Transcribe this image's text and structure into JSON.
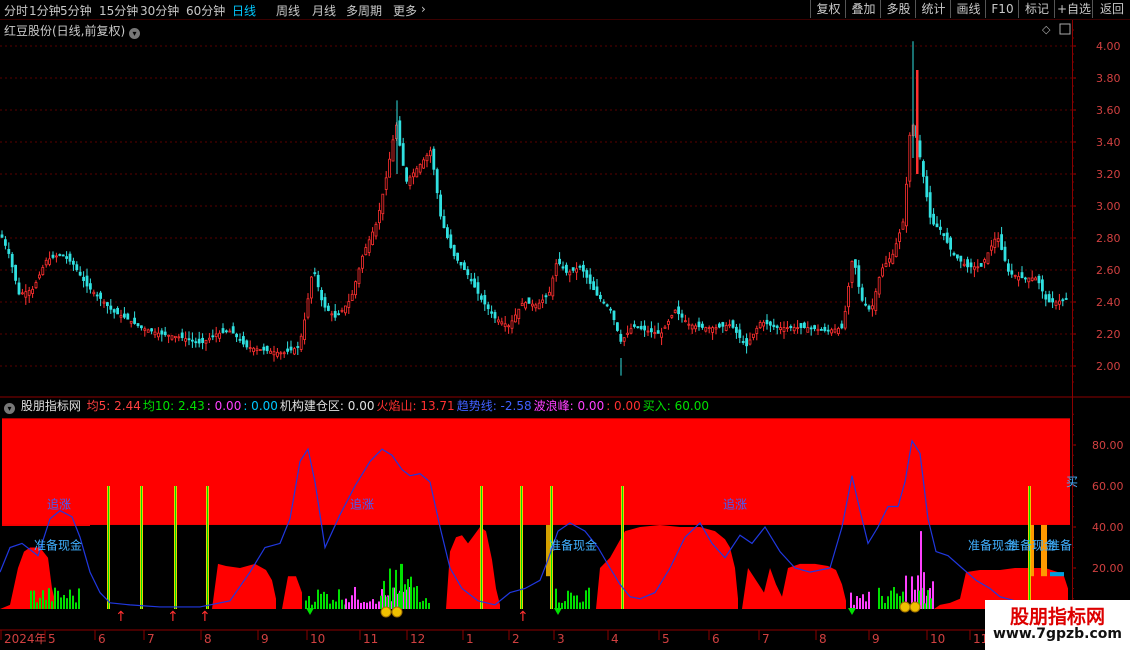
{
  "toolbar": {
    "periods": [
      "分时",
      "1分钟",
      "5分钟",
      "15分钟",
      "30分钟",
      "60分钟",
      "日线",
      "周线",
      "月线",
      "多周期",
      "更多"
    ],
    "active_period": "日线",
    "buttons": [
      "复权",
      "叠加",
      "多股",
      "统计",
      "画线",
      "F10",
      "标记",
      "+自选",
      "返回"
    ]
  },
  "stock_title": "红豆股份(日线,前复权)",
  "indicator": {
    "name": "股朋指标网",
    "items": [
      {
        "label": "均5: 2.44",
        "color": "#ff4040"
      },
      {
        "label": "均10: 2.43",
        "color": "#00e000"
      },
      {
        "label": ": 0.00",
        "color": "#ff40ff"
      },
      {
        "label": ": 0.00",
        "color": "#00c8ff"
      },
      {
        "label": "机构建仓区: 0.00",
        "color": "#e0e0e0"
      },
      {
        "label": "火焰山: 13.71",
        "color": "#ff3030"
      },
      {
        "label": "趋势线: -2.58",
        "color": "#4060ff"
      },
      {
        "label": "波浪峰: 0.00",
        "color": "#ff40ff"
      },
      {
        "label": ": 0.00",
        "color": "#ff3030"
      },
      {
        "label": "买入: 60.00",
        "color": "#00e000"
      }
    ]
  },
  "watermark": {
    "line1": "股朋指标网",
    "line2": "www.7gpzb.com"
  },
  "colors": {
    "up": "#ff3030",
    "down": "#30e0e0",
    "grid": "#5a0000",
    "flame": "#ff0000",
    "trend": "#2038e0",
    "buy": "#00e000"
  },
  "chart_data": [
    {
      "type": "candlestick",
      "title": "红豆股份(日线,前复权)",
      "ylim": [
        1.9,
        4.1
      ],
      "yticks": [
        "2.00",
        "2.20",
        "2.40",
        "2.60",
        "2.80",
        "3.00",
        "3.20",
        "3.40",
        "3.60",
        "3.80",
        "4.00"
      ],
      "x_labels": [
        "2024年",
        "5",
        "6",
        "7",
        "8",
        "9",
        "10",
        "11",
        "12",
        "1",
        "2",
        "3",
        "4",
        "5",
        "6",
        "7",
        "8",
        "9",
        "10",
        "11"
      ],
      "close_path": [
        [
          0,
          2.82
        ],
        [
          8,
          2.7
        ],
        [
          18,
          2.45
        ],
        [
          32,
          2.48
        ],
        [
          45,
          2.66
        ],
        [
          60,
          2.7
        ],
        [
          72,
          2.64
        ],
        [
          86,
          2.5
        ],
        [
          100,
          2.42
        ],
        [
          112,
          2.34
        ],
        [
          125,
          2.3
        ],
        [
          140,
          2.24
        ],
        [
          160,
          2.2
        ],
        [
          180,
          2.18
        ],
        [
          200,
          2.14
        ],
        [
          215,
          2.2
        ],
        [
          230,
          2.22
        ],
        [
          245,
          2.12
        ],
        [
          262,
          2.1
        ],
        [
          282,
          2.08
        ],
        [
          298,
          2.12
        ],
        [
          304,
          2.3
        ],
        [
          312,
          2.62
        ],
        [
          322,
          2.38
        ],
        [
          335,
          2.3
        ],
        [
          350,
          2.42
        ],
        [
          362,
          2.7
        ],
        [
          376,
          2.9
        ],
        [
          386,
          3.2
        ],
        [
          395,
          3.52
        ],
        [
          405,
          3.15
        ],
        [
          418,
          3.25
        ],
        [
          430,
          3.35
        ],
        [
          440,
          2.92
        ],
        [
          452,
          2.7
        ],
        [
          466,
          2.58
        ],
        [
          480,
          2.42
        ],
        [
          494,
          2.3
        ],
        [
          508,
          2.25
        ],
        [
          522,
          2.4
        ],
        [
          536,
          2.38
        ],
        [
          548,
          2.45
        ],
        [
          556,
          2.66
        ],
        [
          566,
          2.58
        ],
        [
          580,
          2.62
        ],
        [
          595,
          2.45
        ],
        [
          610,
          2.35
        ],
        [
          620,
          2.15
        ],
        [
          632,
          2.25
        ],
        [
          646,
          2.22
        ],
        [
          660,
          2.2
        ],
        [
          674,
          2.35
        ],
        [
          688,
          2.26
        ],
        [
          702,
          2.24
        ],
        [
          716,
          2.24
        ],
        [
          730,
          2.26
        ],
        [
          745,
          2.12
        ],
        [
          760,
          2.28
        ],
        [
          775,
          2.24
        ],
        [
          790,
          2.24
        ],
        [
          808,
          2.24
        ],
        [
          825,
          2.22
        ],
        [
          842,
          2.24
        ],
        [
          852,
          2.7
        ],
        [
          860,
          2.42
        ],
        [
          870,
          2.34
        ],
        [
          880,
          2.6
        ],
        [
          892,
          2.7
        ],
        [
          903,
          2.92
        ],
        [
          910,
          3.55
        ],
        [
          915,
          3.45
        ],
        [
          922,
          3.2
        ],
        [
          930,
          2.9
        ],
        [
          940,
          2.85
        ],
        [
          952,
          2.7
        ],
        [
          966,
          2.62
        ],
        [
          980,
          2.62
        ],
        [
          996,
          2.82
        ],
        [
          1008,
          2.58
        ],
        [
          1022,
          2.55
        ],
        [
          1036,
          2.55
        ],
        [
          1046,
          2.4
        ],
        [
          1055,
          2.4
        ],
        [
          1066,
          2.42
        ]
      ]
    },
    {
      "type": "area",
      "title": "股朋指标网",
      "ylim": [
        0,
        100
      ],
      "yticks": [
        "20.00",
        "40.00",
        "60.00",
        "80.00"
      ],
      "series": [
        {
          "name": "火焰山",
          "values": [
            13.71
          ]
        },
        {
          "name": "趋势线",
          "values": [
            -2.58
          ]
        },
        {
          "name": "买入",
          "values": [
            60.0
          ]
        }
      ],
      "labels": [
        {
          "text": "追涨",
          "x": 47,
          "y": 49
        },
        {
          "text": "追涨",
          "x": 350,
          "y": 49
        },
        {
          "text": "追涨",
          "x": 723,
          "y": 49
        },
        {
          "text": "准备现金",
          "x": 34,
          "y": 29
        },
        {
          "text": "准备现金",
          "x": 549,
          "y": 29
        },
        {
          "text": "准备现金",
          "x": 968,
          "y": 29
        },
        {
          "text": "准备现金",
          "x": 1008,
          "y": 29
        },
        {
          "text": "准备",
          "x": 1048,
          "y": 29
        },
        {
          "text": "买",
          "x": 1066,
          "y": 60
        }
      ],
      "trend_path": [
        [
          0,
          18
        ],
        [
          10,
          30
        ],
        [
          22,
          32
        ],
        [
          38,
          26
        ],
        [
          50,
          44
        ],
        [
          60,
          48
        ],
        [
          72,
          45
        ],
        [
          80,
          35
        ],
        [
          90,
          18
        ],
        [
          100,
          8
        ],
        [
          110,
          3
        ],
        [
          130,
          2
        ],
        [
          160,
          1
        ],
        [
          200,
          1
        ],
        [
          230,
          4
        ],
        [
          250,
          18
        ],
        [
          265,
          30
        ],
        [
          280,
          32
        ],
        [
          290,
          44
        ],
        [
          300,
          72
        ],
        [
          308,
          78
        ],
        [
          315,
          62
        ],
        [
          325,
          30
        ],
        [
          340,
          46
        ],
        [
          355,
          60
        ],
        [
          370,
          72
        ],
        [
          382,
          78
        ],
        [
          392,
          75
        ],
        [
          402,
          68
        ],
        [
          410,
          65
        ],
        [
          420,
          66
        ],
        [
          430,
          62
        ],
        [
          440,
          40
        ],
        [
          450,
          20
        ],
        [
          462,
          10
        ],
        [
          478,
          4
        ],
        [
          495,
          2
        ],
        [
          510,
          8
        ],
        [
          525,
          10
        ],
        [
          540,
          14
        ],
        [
          548,
          24
        ],
        [
          558,
          38
        ],
        [
          570,
          42
        ],
        [
          585,
          38
        ],
        [
          598,
          30
        ],
        [
          610,
          20
        ],
        [
          620,
          12
        ],
        [
          630,
          6
        ],
        [
          640,
          5
        ],
        [
          655,
          8
        ],
        [
          670,
          20
        ],
        [
          685,
          35
        ],
        [
          700,
          42
        ],
        [
          712,
          32
        ],
        [
          725,
          25
        ],
        [
          740,
          36
        ],
        [
          752,
          32
        ],
        [
          765,
          40
        ],
        [
          780,
          28
        ],
        [
          795,
          20
        ],
        [
          810,
          18
        ],
        [
          830,
          20
        ],
        [
          842,
          40
        ],
        [
          852,
          65
        ],
        [
          860,
          48
        ],
        [
          868,
          32
        ],
        [
          878,
          40
        ],
        [
          888,
          50
        ],
        [
          898,
          50
        ],
        [
          905,
          62
        ],
        [
          912,
          82
        ],
        [
          920,
          76
        ],
        [
          928,
          44
        ],
        [
          936,
          28
        ],
        [
          948,
          26
        ],
        [
          962,
          20
        ],
        [
          976,
          14
        ],
        [
          990,
          10
        ],
        [
          1000,
          6
        ],
        [
          1015,
          4
        ],
        [
          1030,
          4
        ]
      ],
      "flame_hills": [
        [
          [
            0,
            0
          ],
          [
            10,
            2
          ],
          [
            18,
            20
          ],
          [
            24,
            28
          ],
          [
            30,
            30
          ],
          [
            40,
            30
          ],
          [
            48,
            25
          ],
          [
            52,
            10
          ],
          [
            56,
            2
          ]
        ],
        [
          [
            212,
            0
          ],
          [
            218,
            22
          ],
          [
            226,
            21
          ],
          [
            240,
            20
          ],
          [
            255,
            22
          ],
          [
            266,
            19
          ],
          [
            272,
            14
          ],
          [
            276,
            5
          ]
        ],
        [
          [
            282,
            0
          ],
          [
            288,
            16
          ],
          [
            296,
            16
          ],
          [
            302,
            8
          ]
        ],
        [
          [
            446,
            0
          ],
          [
            450,
            28
          ],
          [
            456,
            35
          ],
          [
            462,
            36
          ],
          [
            468,
            32
          ],
          [
            474,
            36
          ],
          [
            480,
            40
          ],
          [
            486,
            38
          ],
          [
            492,
            24
          ],
          [
            496,
            10
          ],
          [
            500,
            2
          ]
        ],
        [
          [
            596,
            0
          ],
          [
            600,
            20
          ],
          [
            610,
            25
          ],
          [
            625,
            38
          ],
          [
            640,
            40
          ],
          [
            660,
            41
          ],
          [
            680,
            40
          ],
          [
            700,
            40
          ],
          [
            715,
            38
          ],
          [
            725,
            34
          ],
          [
            730,
            30
          ],
          [
            735,
            20
          ],
          [
            738,
            5
          ]
        ],
        [
          [
            742,
            0
          ],
          [
            748,
            20
          ],
          [
            756,
            14
          ],
          [
            764,
            8
          ],
          [
            770,
            20
          ],
          [
            776,
            12
          ],
          [
            782,
            6
          ],
          [
            788,
            20
          ],
          [
            800,
            22
          ],
          [
            815,
            22
          ],
          [
            828,
            21
          ],
          [
            836,
            19
          ],
          [
            842,
            12
          ],
          [
            846,
            4
          ]
        ],
        [
          [
            934,
            0
          ],
          [
            940,
            2
          ],
          [
            950,
            3
          ],
          [
            960,
            5
          ],
          [
            966,
            18
          ],
          [
            980,
            19
          ],
          [
            1000,
            19
          ],
          [
            1015,
            20
          ],
          [
            1030,
            20
          ],
          [
            1045,
            20
          ],
          [
            1058,
            18
          ],
          [
            1064,
            16
          ],
          [
            1068,
            10
          ]
        ]
      ],
      "buy_spikes": [
        109,
        142,
        176,
        208,
        482,
        522,
        552,
        623,
        1030
      ]
    }
  ]
}
